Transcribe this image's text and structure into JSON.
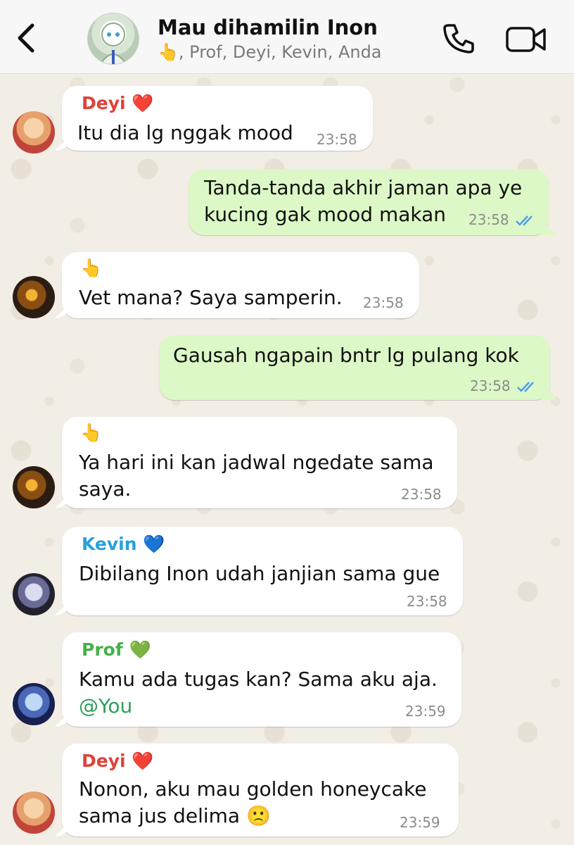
{
  "header": {
    "title": "Mau dihamilin Inon",
    "subtitle": "👆, Prof, Deyi, Kevin, Anda"
  },
  "messages": [
    {
      "sender": "Deyi",
      "sender_emoji": "❤️",
      "sender_color": "#e0413b",
      "lines": [
        "Itu dia lg nggak mood"
      ],
      "time": "23:58"
    },
    {
      "outgoing": true,
      "lines": [
        "Tanda-tanda akhir jaman apa ye",
        "kucing gak mood makan"
      ],
      "time": "23:58"
    },
    {
      "sender_label": "👆",
      "lines": [
        "Vet mana? Saya samperin."
      ],
      "time": "23:58"
    },
    {
      "outgoing": true,
      "lines": [
        "Gausah ngapain bntr lg pulang kok"
      ],
      "time": "23:58"
    },
    {
      "sender_label": "👆",
      "lines": [
        "Ya hari ini kan jadwal ngedate sama",
        "saya."
      ],
      "time": "23:58"
    },
    {
      "sender": "Kevin",
      "sender_emoji": "💙",
      "sender_color": "#2aa0dd",
      "lines": [
        "Dibilang Inon udah janjian sama gue"
      ],
      "time": "23:58"
    },
    {
      "sender": "Prof",
      "sender_emoji": "💚",
      "sender_color": "#45b04a",
      "lines": [
        "Kamu ada tugas kan? Sama aku aja."
      ],
      "mention": "@You",
      "time": "23:59"
    },
    {
      "sender": "Deyi",
      "sender_emoji": "❤️",
      "sender_color": "#e0413b",
      "lines": [
        "Nonon, aku mau golden honeycake",
        "sama jus delima 🙁"
      ],
      "time": "23:59"
    }
  ],
  "colors": {
    "incoming_bubble": "#ffffff",
    "outgoing_bubble": "#dcf8c6",
    "read_ticks": "#4f9de8",
    "mention": "#2e9e5a"
  }
}
